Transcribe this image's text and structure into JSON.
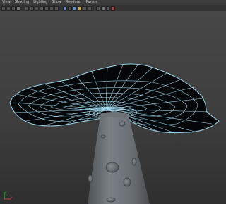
{
  "menubar": {
    "items": [
      {
        "label": "View",
        "name": "menu-view"
      },
      {
        "label": "Shading",
        "name": "menu-shading"
      },
      {
        "label": "Lighting",
        "name": "menu-lighting"
      },
      {
        "label": "Show",
        "name": "menu-show"
      },
      {
        "label": "Renderer",
        "name": "menu-renderer"
      },
      {
        "label": "Panels",
        "name": "menu-panels"
      }
    ]
  },
  "viewport": {
    "background_top": "#474747",
    "background_bottom": "#2f2f2f",
    "wireframe_color": "#9cd6ee",
    "mesh_color": "#6f7378",
    "object": "mushroom-model"
  },
  "axes": {
    "x_label": "x",
    "y_label": "y",
    "x_color": "#e04040",
    "y_color": "#40c040"
  }
}
